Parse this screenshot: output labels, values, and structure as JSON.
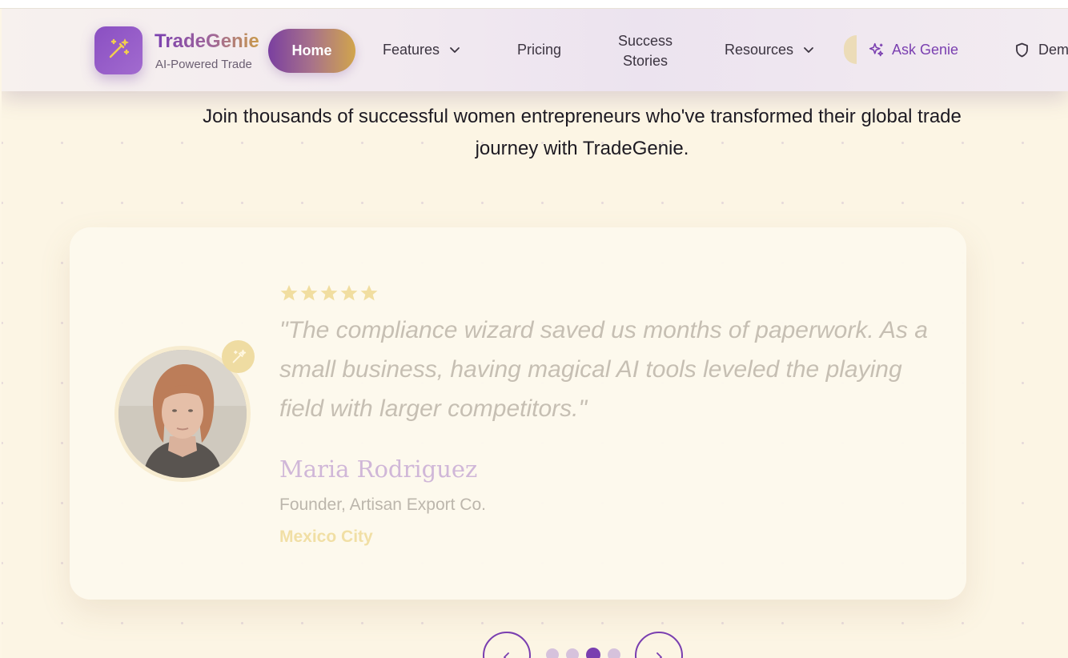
{
  "nav": {
    "brand_name": "TradeGenie",
    "brand_tagline": "AI-Powered Trade",
    "logo_icon": "magic-wand-icon",
    "items": [
      {
        "label": "Home",
        "active": true
      },
      {
        "label": "Features",
        "has_dropdown": true
      },
      {
        "label": "Pricing"
      },
      {
        "label": "Success Stories"
      },
      {
        "label": "Resources",
        "has_dropdown": true
      }
    ],
    "ask_genie": {
      "label": "Ask Genie",
      "icon": "sparkles-icon"
    },
    "demo": {
      "label": "Dem",
      "icon": "shield-icon"
    }
  },
  "section": {
    "subtitle": "Join thousands of successful women entrepreneurs who've transformed their global trade journey with TradeGenie."
  },
  "testimonial": {
    "rating": 5,
    "rating_max": 5,
    "quote": "\"The compliance wizard saved us months of paperwork. As a small business, having magical AI tools leveled the playing field with larger competitors.\"",
    "name": "Maria Rodriguez",
    "role": "Founder, Artisan Export Co.",
    "location": "Mexico City",
    "badge_icon": "wand-sparkle-icon"
  },
  "carousel": {
    "total_slides": 4,
    "active_index": 2,
    "prev_icon": "chevron-left-icon",
    "next_icon": "chevron-right-icon"
  },
  "colors": {
    "brand_purple": "#7a3fb0",
    "brand_gold": "#d1a54c",
    "background": "#fcf5e4"
  }
}
